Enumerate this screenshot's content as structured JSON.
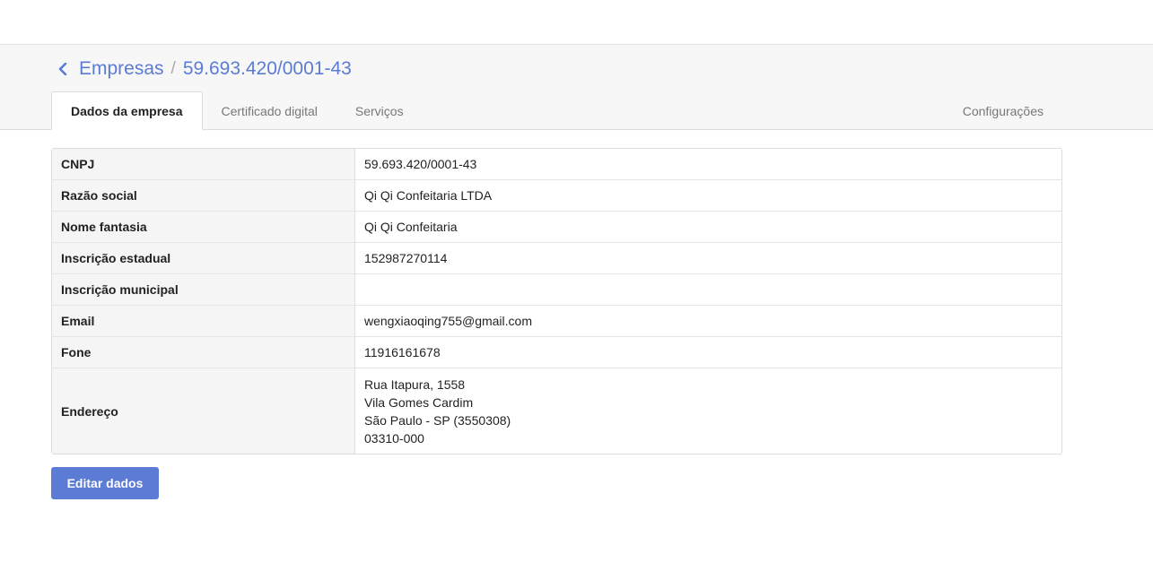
{
  "breadcrumb": {
    "parent": "Empresas",
    "separator": "/",
    "current": "59.693.420/0001-43"
  },
  "tabs": [
    {
      "label": "Dados da empresa",
      "active": true
    },
    {
      "label": "Certificado digital",
      "active": false
    },
    {
      "label": "Serviços",
      "active": false
    },
    {
      "label": "Configurações",
      "active": false
    }
  ],
  "company": {
    "cnpj": {
      "label": "CNPJ",
      "value": "59.693.420/0001-43"
    },
    "razao_social": {
      "label": "Razão social",
      "value": "Qi Qi Confeitaria LTDA"
    },
    "nome_fantasia": {
      "label": "Nome fantasia",
      "value": "Qi Qi Confeitaria"
    },
    "inscricao_estadual": {
      "label": "Inscrição estadual",
      "value": "152987270114"
    },
    "inscricao_municipal": {
      "label": "Inscrição municipal",
      "value": ""
    },
    "email": {
      "label": "Email",
      "value": "wengxiaoqing755@gmail.com"
    },
    "fone": {
      "label": "Fone",
      "value": "11916161678"
    },
    "endereco": {
      "label": "Endereço",
      "lines": [
        "Rua Itapura, 1558",
        "Vila Gomes Cardim",
        "São Paulo - SP (3550308)",
        "03310-000"
      ]
    }
  },
  "actions": {
    "edit_label": "Editar dados"
  },
  "colors": {
    "accent": "#5b7bd5"
  },
  "icons": {
    "back": "chevron-left-icon"
  }
}
